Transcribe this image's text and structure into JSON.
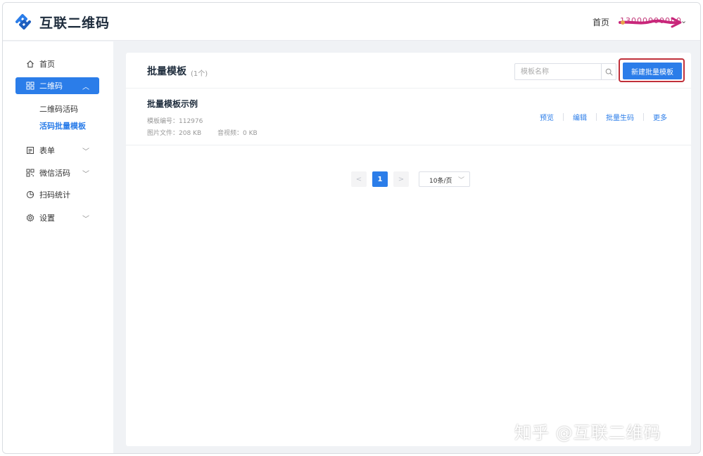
{
  "header": {
    "brand": "互联二维码",
    "home_link": "首页",
    "user": "13000000000"
  },
  "sidebar": {
    "items": [
      {
        "label": "首页",
        "icon": "home-icon"
      },
      {
        "label": "二维码",
        "icon": "grid-icon",
        "expanded": true,
        "active": true
      },
      {
        "label": "表单",
        "icon": "form-icon"
      },
      {
        "label": "微信活码",
        "icon": "qrcode-icon"
      },
      {
        "label": "扫码统计",
        "icon": "pie-chart-icon"
      },
      {
        "label": "设置",
        "icon": "gear-icon"
      }
    ],
    "subitems": [
      {
        "label": "二维码活码"
      },
      {
        "label": "活码批量模板",
        "active": true
      }
    ]
  },
  "main": {
    "title": "批量模板",
    "count": "(1个)",
    "search_placeholder": "模板名称",
    "new_button": "新建批量模板",
    "templates": [
      {
        "name": "批量模板示例",
        "id_label": "模板编号：112976",
        "image_label": "图片文件：208 KB",
        "audio_label": "音视频：0 KB",
        "actions": [
          "预览",
          "编辑",
          "批量生码",
          "更多"
        ]
      }
    ],
    "pagination": {
      "prev": "<",
      "current_page": "1",
      "next": ">",
      "page_size": "10条/页"
    }
  },
  "watermark": "知乎 @互联二维码",
  "colors": {
    "accent": "#2b7de9",
    "highlight_border": "#c0303a",
    "background": "#f0f2f5"
  }
}
